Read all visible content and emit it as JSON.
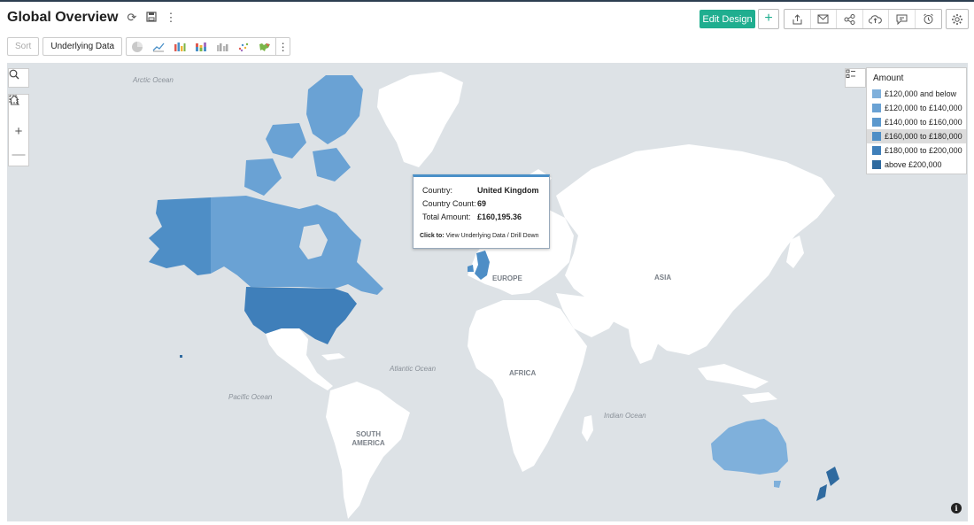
{
  "header": {
    "title": "Global Overview",
    "edit_label": "Edit Design"
  },
  "toolbar": {
    "sort_label": "Sort",
    "underlying_label": "Underlying Data"
  },
  "map": {
    "ocean_labels": [
      "Arctic Ocean",
      "Atlantic Ocean",
      "Pacific Ocean",
      "Indian Ocean"
    ],
    "continent_labels": [
      "EUROPE",
      "ASIA",
      "AFRICA",
      "SOUTH AMERICA"
    ],
    "colors": {
      "ocean": "#dde2e6",
      "land": "#ffffff",
      "b1": "#7fb0db",
      "b2": "#6aa2d4",
      "b3": "#5b98cd",
      "b4": "#4e8ec6",
      "b5": "#3f7fba",
      "b6": "#2f6a9f"
    }
  },
  "legend": {
    "title": "Amount",
    "items": [
      {
        "label": "£120,000 and below",
        "color": "#7fb0db"
      },
      {
        "label": "£120,000 to £140,000",
        "color": "#6aa2d4"
      },
      {
        "label": "£140,000 to £160,000",
        "color": "#5b98cd"
      },
      {
        "label": "£160,000 to £180,000",
        "color": "#4e8ec6"
      },
      {
        "label": "£180,000 to £200,000",
        "color": "#3f7fba"
      },
      {
        "label": "above £200,000",
        "color": "#2f6a9f"
      }
    ]
  },
  "tooltip": {
    "country_key": "Country:",
    "country_val": "United Kingdom",
    "count_key": "Country Count:",
    "count_val": "69",
    "amount_key": "Total Amount:",
    "amount_val": "£160,195.36",
    "click_to": "Click to:",
    "click_action": "View Underlying Data / Drill Down"
  }
}
